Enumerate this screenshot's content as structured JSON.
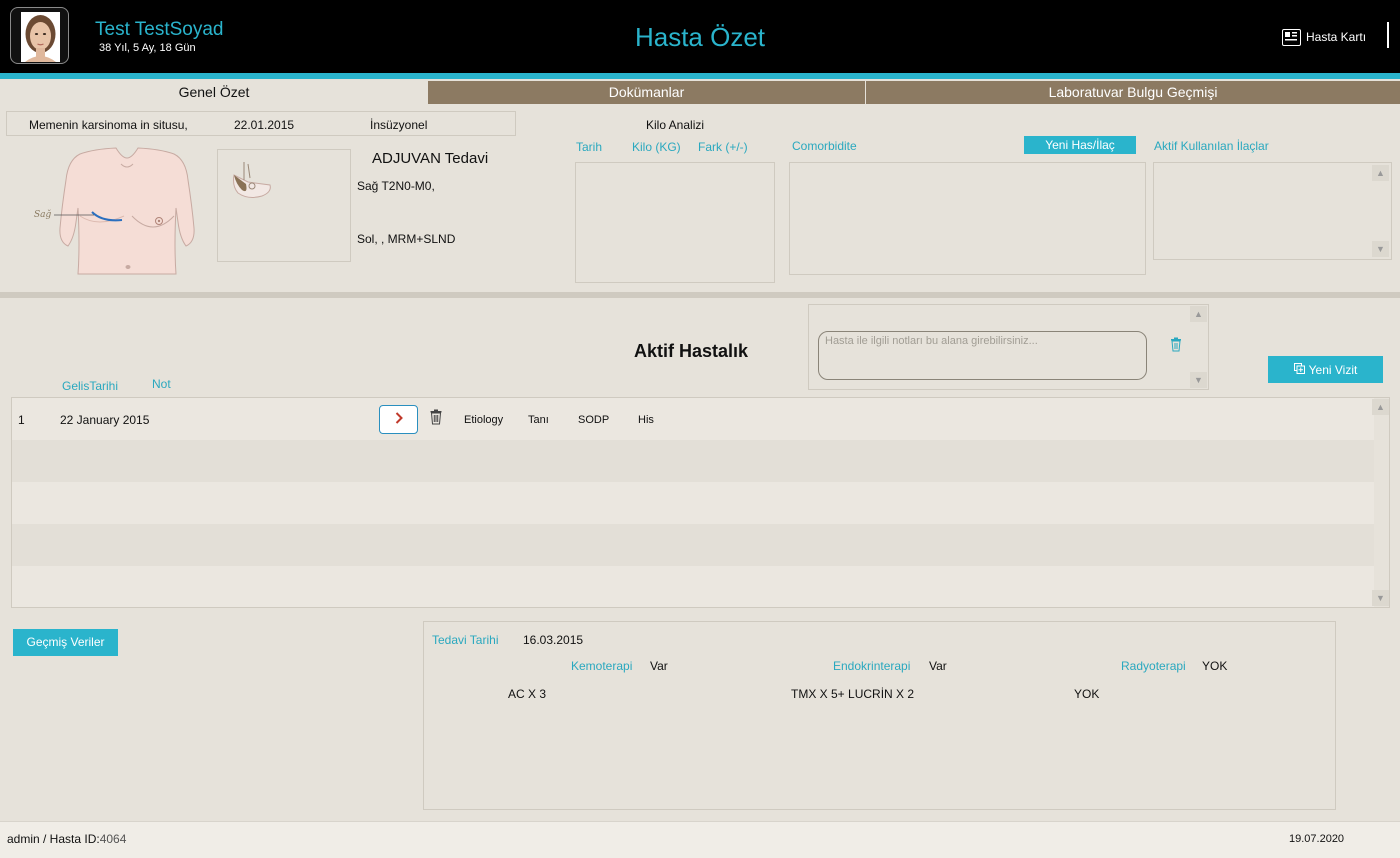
{
  "header": {
    "patient_name": "Test TestSoyad",
    "patient_age": "38 Yıl, 5 Ay, 18 Gün",
    "title": "Hasta Özet",
    "card_button": "Hasta Kartı"
  },
  "tabs": [
    {
      "label": "Genel Özet",
      "active": true
    },
    {
      "label": "Dokümanlar",
      "active": false
    },
    {
      "label": "Laboratuvar Bulgu Geçmişi",
      "active": false
    }
  ],
  "diagnosis": {
    "name": "Memenin karsinoma in situsu,",
    "date": "22.01.2015",
    "type": "İnsüzyonel"
  },
  "diagram": {
    "side_label": "Sağ"
  },
  "adjuvant": {
    "title": "ADJUVAN Tedavi",
    "right": "Sağ T2N0-M0,",
    "left": "Sol, ,   MRM+SLND"
  },
  "weight": {
    "title": "Kilo Analizi",
    "columns": [
      "Tarih",
      "Kilo (KG)",
      "Fark (+/-)"
    ]
  },
  "comorbidity": {
    "label": "Comorbidite"
  },
  "drugs": {
    "new_button": "Yeni Has/İlaç",
    "label": "Aktif Kullanılan İlaçlar"
  },
  "active_disease": {
    "title": "Aktif Hastalık",
    "notes_placeholder": "Hasta ile ilgili notları bu alana girebilirsiniz...",
    "new_visit_button": "Yeni Vizit",
    "columns": [
      "GelisTarihi",
      "Not"
    ],
    "rows": [
      {
        "index": "1",
        "date": "22 January 2015",
        "etiology": "Etiology",
        "diagnosis": "Tanı",
        "sodp": "SODP",
        "his": "His"
      }
    ]
  },
  "history_button": "Geçmiş Veriler",
  "treatment": {
    "date_label": "Tedavi Tarihi",
    "date": "16.03.2015",
    "chemo_label": "Kemoterapi",
    "chemo_value": "Var",
    "chemo_detail": "AC X 3",
    "endo_label": "Endokrinterapi",
    "endo_value": "Var",
    "endo_detail": "TMX X 5+ LUCRİN X 2",
    "radio_label": "Radyoterapi",
    "radio_value": "YOK",
    "radio_detail": "YOK"
  },
  "footer": {
    "user": "admin / Hasta ID:",
    "patient_id": "4064",
    "date": "19.07.2020"
  },
  "colors": {
    "accent": "#2ab4cc",
    "tab_inactive": "#8c7a62",
    "background": "#e6e2da"
  }
}
